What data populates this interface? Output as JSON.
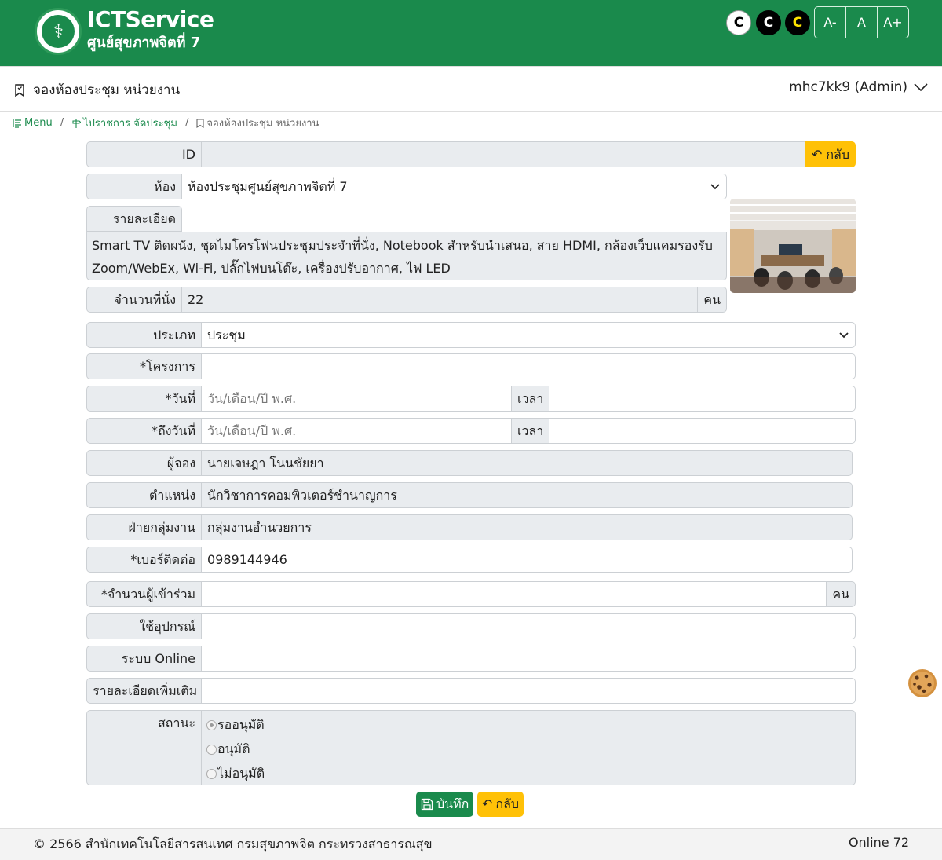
{
  "header": {
    "title": "ICTService",
    "subtitle": "ศูนย์สุขภาพจิตที่ 7",
    "contrast": [
      "C",
      "C",
      "C"
    ],
    "font_sizes": [
      "A-",
      "A",
      "A+"
    ]
  },
  "titlebar": {
    "page_title": "จองห้องประชุม หน่วยงาน",
    "user": "mhc7kk9 (Admin)"
  },
  "breadcrumb": {
    "menu": "Menu",
    "agenda": "ไปราชการ จัดประชุม",
    "current": "จองห้องประชุม หน่วยงาน"
  },
  "form": {
    "id": {
      "label": "ID",
      "value": ""
    },
    "back_top": "กลับ",
    "room": {
      "label": "ห้อง",
      "value": "ห้องประชุมศูนย์สุขภาพจิตที่ 7"
    },
    "detail": {
      "label": "รายละเอียด",
      "line1": "Smart TV ติดผนัง, ชุดไมโครโฟนประชุมประจำที่นั่ง, Notebook สำหรับนำเสนอ, สาย HDMI, กล้องเว็บแคมรองรับ",
      "line2": "Zoom/WebEx, Wi-Fi, ปลั๊กไฟบนโต๊ะ, เครื่องปรับอากาศ, ไฟ LED"
    },
    "seats": {
      "label": "จำนวนที่นั่ง",
      "value": "22",
      "unit": "คน"
    },
    "type": {
      "label": "ประเภท",
      "value": "ประชุม"
    },
    "project": {
      "label": "*โครงการ",
      "value": ""
    },
    "date_from": {
      "label": "*วันที่",
      "placeholder": "วัน/เดือน/ปี พ.ศ.",
      "time_label": "เวลา",
      "time": ""
    },
    "date_to": {
      "label": "*ถึงวันที่",
      "placeholder": "วัน/เดือน/ปี พ.ศ.",
      "time_label": "เวลา",
      "time": ""
    },
    "booker": {
      "label": "ผู้จอง",
      "value": "นายเจษฎา โนนชัยยา"
    },
    "position": {
      "label": "ตำแหน่ง",
      "value": "นักวิชาการคอมพิวเตอร์ชำนาญการ"
    },
    "division": {
      "label": "ฝ่ายกลุ่มงาน",
      "value": "กลุ่มงานอำนวยการ"
    },
    "phone": {
      "label": "*เบอร์ติดต่อ",
      "value": "0989144946"
    },
    "attendees": {
      "label": "*จำนวนผู้เข้าร่วม",
      "value": "",
      "unit": "คน"
    },
    "equipment": {
      "label": "ใช้อุปกรณ์",
      "value": ""
    },
    "online": {
      "label": "ระบบ Online",
      "value": ""
    },
    "more": {
      "label": "รายละเอียดเพิ่มเติม",
      "value": ""
    },
    "status": {
      "label": "สถานะ",
      "options": [
        "รออนุมัติ",
        "อนุมัติ",
        "ไม่อนุมัติ"
      ],
      "selected": "รออนุมัติ"
    },
    "save": "บันทึก",
    "back": "กลับ"
  },
  "footer": {
    "copyright": "© 2566 สำนักเทคโนโลยีสารสนเทศ กรมสุขภาพจิต กระทรวงสาธารณสุข",
    "online": "Online 72"
  },
  "colors": {
    "primary": "#1a8a4c",
    "warning": "#ffc107"
  }
}
